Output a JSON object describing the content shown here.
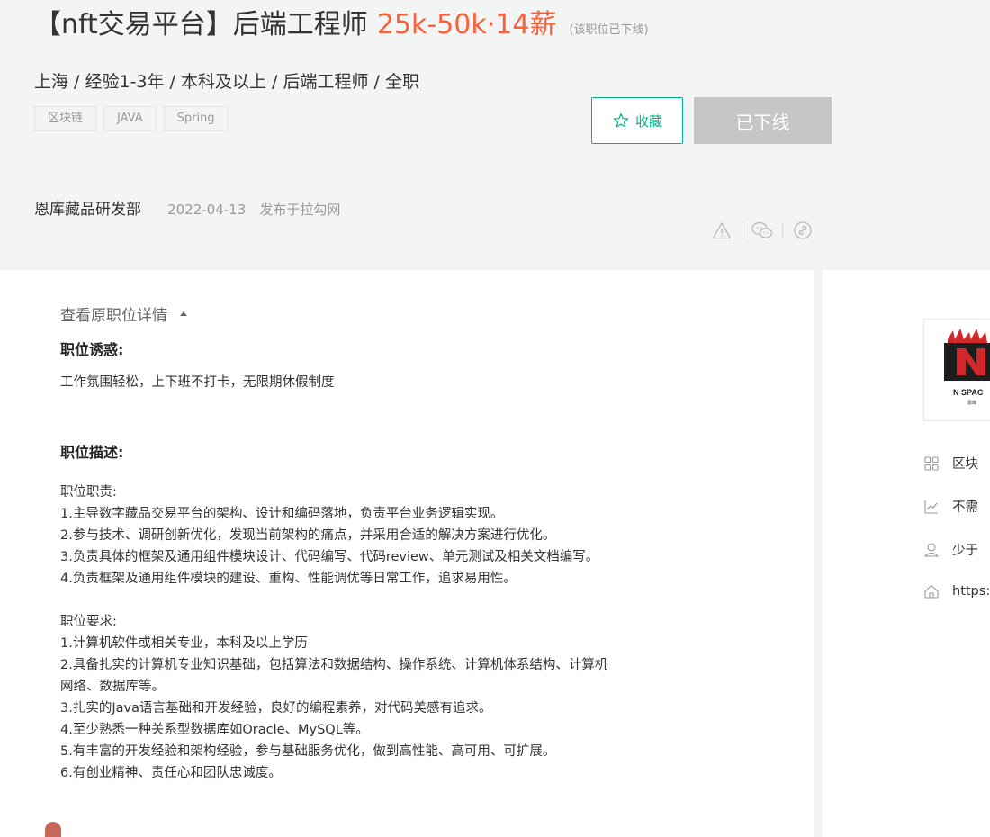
{
  "header": {
    "job_title": "【nft交易平台】后端工程师",
    "salary": "25k-50k·14薪",
    "offline_note": "(该职位已下线)",
    "meta": "上海 / 经验1-3年 / 本科及以上 / 后端工程师 / 全职",
    "tags": [
      "区块链",
      "JAVA",
      "Spring"
    ],
    "favorite_label": "收藏",
    "offline_label": "已下线",
    "department": "恩库藏品研发部",
    "date": "2022-04-13",
    "publish_text": "发布于拉勾网"
  },
  "share_icons": [
    "report-icon",
    "wechat-icon",
    "link-icon"
  ],
  "detail": {
    "view_original": "查看原职位详情",
    "perks_title": "职位诱惑:",
    "perks_text": "工作氛围轻松，上下班不打卡，无限期休假制度",
    "desc_title": "职位描述:",
    "duties_heading": "职位职责:",
    "duties": [
      "1.主导数字藏品交易平台的架构、设计和编码落地，负责平台业务逻辑实现。",
      "2.参与技术、调研创新优化，发现当前架构的痛点，并采用合适的解决方案进行优化。",
      "3.负责具体的框架及通用组件模块设计、代码编写、代码review、单元测试及相关文档编写。",
      "4.负责框架及通用组件模块的建设、重构、性能调优等日常工作，追求易用性。"
    ],
    "requirements_heading": "职位要求:",
    "requirements": [
      "1.计算机软件或相关专业，本科及以上学历",
      "2.具备扎实的计算机专业知识基础，包括算法和数据结构、操作系统、计算机体系结构、计算机",
      "网络、数据库等。",
      "3.扎实的Java语言基础和开发经验，良好的编程素养，对代码美感有追求。",
      "4.至少熟悉一种关系型数据库如Oracle、MySQL等。",
      "5.有丰富的开发经验和架构经验，参与基础服务优化，做到高性能、高可用、可扩展。",
      "6.有创业精神、责任心和团队忠诚度。"
    ]
  },
  "company": {
    "logo_text": "N SPAC",
    "logo_subtext": "恩库",
    "industry": "区块",
    "financing": "不需",
    "size": "少于",
    "website": "https:"
  },
  "colors": {
    "accent": "#00b38a",
    "salary": "#fd5f39",
    "disabled": "#c4c7c6"
  }
}
